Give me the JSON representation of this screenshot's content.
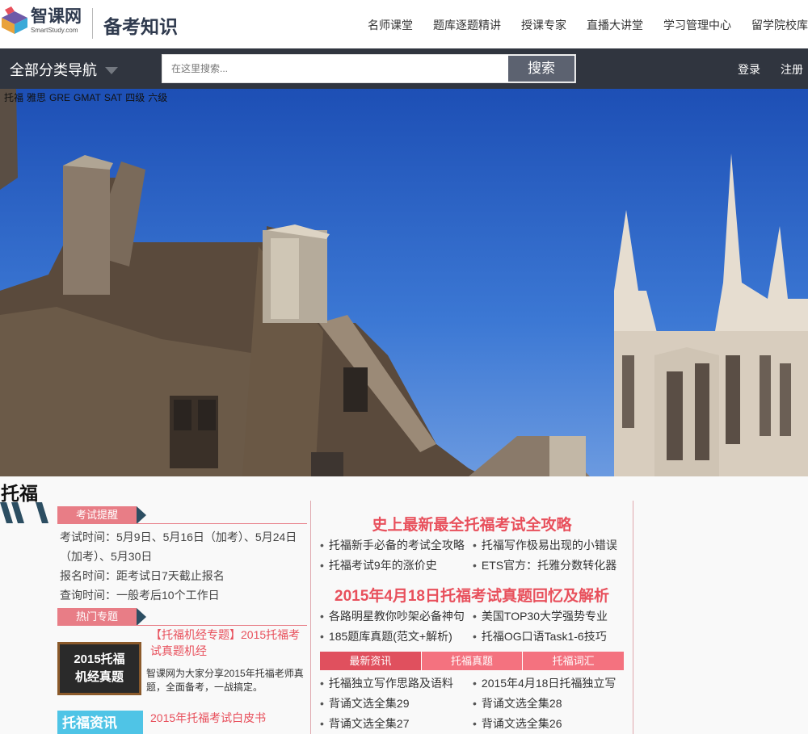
{
  "header": {
    "logo_cn": "智课网",
    "logo_en": "SmartStudy.com",
    "section_title": "备考知识",
    "nav": [
      "名师课堂",
      "题库逐题精讲",
      "授课专家",
      "直播大讲堂",
      "学习管理中心",
      "留学院校库"
    ]
  },
  "bar": {
    "category_nav": "全部分类导航",
    "search_placeholder": "在这里搜索...",
    "search_button": "搜索",
    "login": "登录",
    "register": "注册"
  },
  "banner": {
    "tags": [
      "托福",
      "雅思",
      "GRE",
      "GMAT",
      "SAT",
      "四级",
      "六级"
    ]
  },
  "content": {
    "section_title": "托福",
    "exam_reminder": {
      "label": "考试提醒",
      "lines": [
        "考试时间：5月9日、5月16日（加考）、5月24日",
        "（加考）、5月30日",
        "报名时间：距考试日7天截止报名",
        "查询时间：一般考后10个工作日"
      ]
    },
    "hot_topics": {
      "label": "热门专题",
      "promo1_lines": [
        "2015托福",
        "机经真题"
      ],
      "item1_title_l1": "【托福机经专题】2015托福考",
      "item1_title_l2": "试真题机经",
      "item1_desc": "智课网为大家分享2015年托福老师真题，全面备考，一战搞定。",
      "promo2_text": "托福资讯",
      "item2_title": "2015年托福考试白皮书"
    },
    "feature1": {
      "title": "史上最新最全托福考试全攻略",
      "links": [
        "托福新手必备的考试全攻略",
        "托福写作极易出现的小错误",
        "托福考试9年的涨价史",
        "ETS官方：托雅分数转化器"
      ]
    },
    "feature2": {
      "title": "2015年4月18日托福考试真题回忆及解析",
      "links": [
        "各路明星教你吵架必备神句",
        "美国TOP30大学强势专业",
        "185题库真题(范文+解析)",
        "托福OG口语Task1-6技巧"
      ]
    },
    "tabs": [
      "最新资讯",
      "托福真题",
      "托福词汇"
    ],
    "news": [
      "托福独立写作思路及语料",
      "2015年4月18日托福独立写",
      "背诵文选全集29",
      "背诵文选全集28",
      "背诵文选全集27",
      "背诵文选全集26"
    ]
  }
}
